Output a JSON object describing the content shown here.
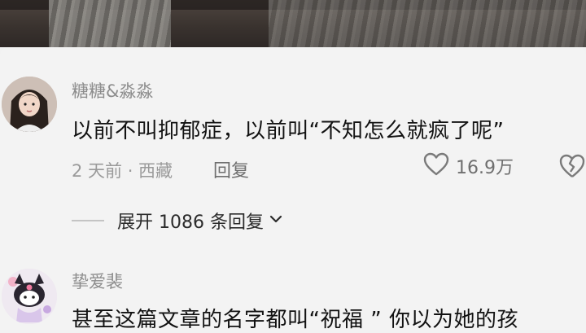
{
  "comments": [
    {
      "username": "糖糖&淼淼",
      "text": "以前不叫抑郁症，以前叫“不知怎么就疯了呢”",
      "meta": "2 天前 · 西藏",
      "reply_label": "回复",
      "likes": "16.9万",
      "expand_replies": "展开 1086 条回复"
    },
    {
      "username": "挚爱裴",
      "text": "甚至这篇文章的名字都叫“祝福 ” 你以为她的孩"
    }
  ],
  "icons": {
    "like": "heart-outline-icon",
    "dislike": "broken-heart-icon",
    "expand": "chevron-down-icon"
  },
  "colors": {
    "background": "#f3f3f3",
    "text_primary": "#121212",
    "text_secondary": "#8d8d8d"
  }
}
